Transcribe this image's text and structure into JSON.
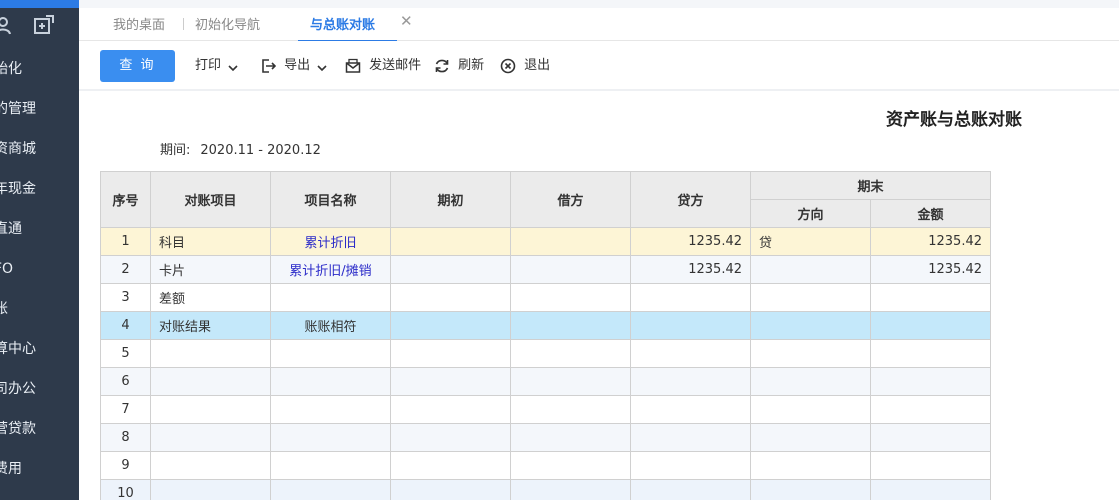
{
  "sidebar": {
    "items": [
      "始化",
      "的管理",
      "资商城",
      "年现金",
      "直通",
      "FO",
      "账",
      "算中心",
      "司办公",
      "营贷款",
      "费用"
    ]
  },
  "tabs": {
    "items": [
      {
        "label": "我的桌面",
        "active": false
      },
      {
        "label": "初始化导航",
        "active": false
      },
      {
        "label": "与总账对账",
        "active": true
      }
    ]
  },
  "toolbar": {
    "query": "查 询",
    "print": "打印",
    "export": "导出",
    "email": "发送邮件",
    "refresh": "刷新",
    "exit": "退出"
  },
  "report": {
    "title": "资产账与总账对账",
    "period_label": "期间:",
    "period_value": "2020.11 - 2020.12"
  },
  "table": {
    "headers": {
      "seq": "序号",
      "item": "对账项目",
      "name": "项目名称",
      "opening": "期初",
      "debit": "借方",
      "credit": "贷方",
      "closing": "期末",
      "direction": "方向",
      "amount": "金额"
    },
    "rows": [
      {
        "seq": "1",
        "item": "科目",
        "name": "累计折旧",
        "opening": "",
        "debit": "",
        "credit": "1235.42",
        "direction": "贷",
        "amount": "1235.42"
      },
      {
        "seq": "2",
        "item": "卡片",
        "name": "累计折旧/摊销",
        "opening": "",
        "debit": "",
        "credit": "1235.42",
        "direction": "",
        "amount": "1235.42"
      },
      {
        "seq": "3",
        "item": "差额",
        "name": "",
        "opening": "",
        "debit": "",
        "credit": "",
        "direction": "",
        "amount": ""
      },
      {
        "seq": "4",
        "item": "对账结果",
        "name": "账账相符",
        "opening": "",
        "debit": "",
        "credit": "",
        "direction": "",
        "amount": ""
      },
      {
        "seq": "5",
        "item": "",
        "name": "",
        "opening": "",
        "debit": "",
        "credit": "",
        "direction": "",
        "amount": ""
      },
      {
        "seq": "6",
        "item": "",
        "name": "",
        "opening": "",
        "debit": "",
        "credit": "",
        "direction": "",
        "amount": ""
      },
      {
        "seq": "7",
        "item": "",
        "name": "",
        "opening": "",
        "debit": "",
        "credit": "",
        "direction": "",
        "amount": ""
      },
      {
        "seq": "8",
        "item": "",
        "name": "",
        "opening": "",
        "debit": "",
        "credit": "",
        "direction": "",
        "amount": ""
      },
      {
        "seq": "9",
        "item": "",
        "name": "",
        "opening": "",
        "debit": "",
        "credit": "",
        "direction": "",
        "amount": ""
      },
      {
        "seq": "10",
        "item": "",
        "name": "",
        "opening": "",
        "debit": "",
        "credit": "",
        "direction": "",
        "amount": ""
      }
    ]
  },
  "colors": {
    "accent": "#3a8ef0",
    "sidebar_bg": "#2e3a4b",
    "row_highlight_yellow": "#fdf5d6",
    "row_highlight_blue": "#c4e8fa",
    "link_text": "#2b2bc9"
  },
  "icons": {
    "sidebar_top": [
      "user-icon",
      "add-window-icon"
    ],
    "export": "export-icon",
    "email": "email-icon",
    "refresh": "refresh-icon",
    "exit": "exit-icon",
    "tab_close": "close-icon"
  }
}
